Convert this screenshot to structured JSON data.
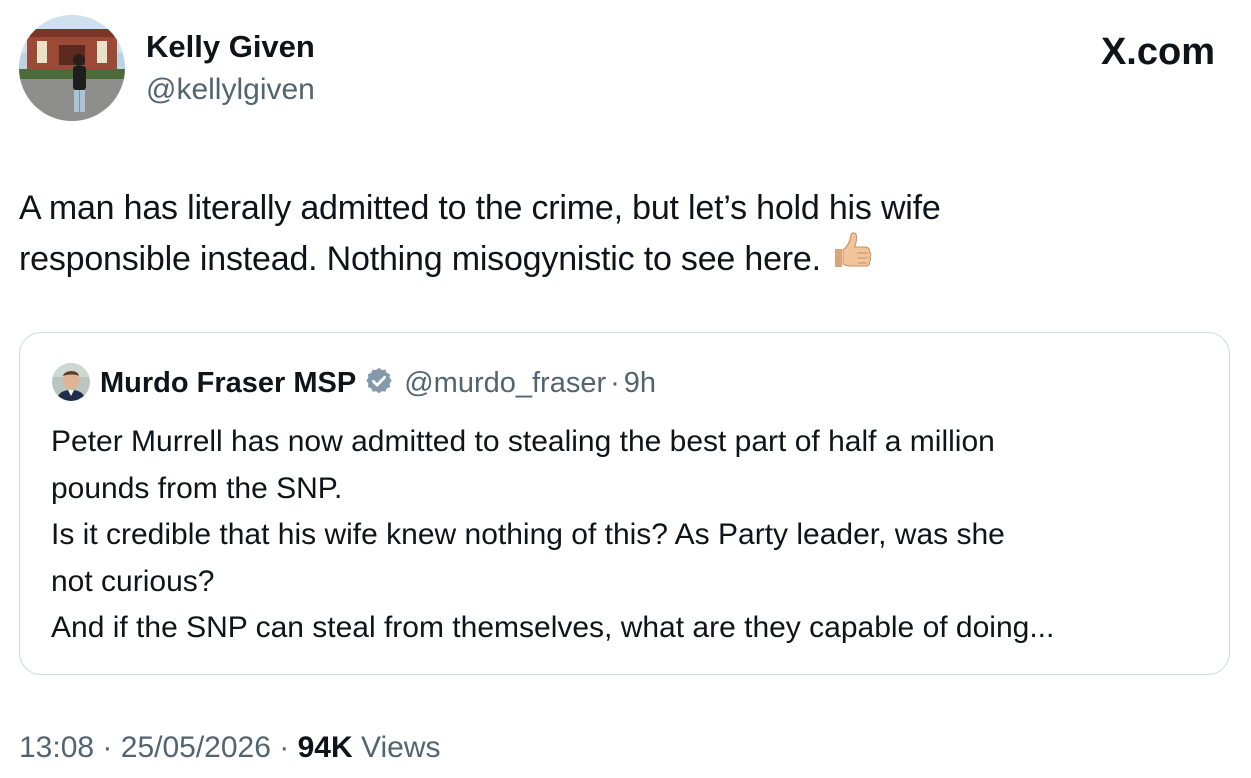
{
  "author": {
    "name": "Kelly Given",
    "handle": "@kellylgiven"
  },
  "brand": "X.com",
  "tweet": {
    "lines": [
      "A man has literally admitted to the crime, but let’s hold his wife",
      "responsible instead. Nothing misogynistic to see here."
    ],
    "emoji": "thumbs-up-icon"
  },
  "quoted": {
    "name": "Murdo Fraser MSP",
    "verified_icon": "verified-badge-icon",
    "handle": "@murdo_fraser",
    "separator": "·",
    "time": "9h",
    "lines": [
      "Peter Murrell has now admitted to stealing the best part of half a million",
      "pounds from the SNP.",
      "Is it credible that his wife knew nothing of this?  As Party leader, was she",
      "not curious?",
      "And if the SNP can steal from themselves, what are they capable of doing..."
    ]
  },
  "footer": {
    "time": "13:08",
    "separator": "·",
    "date": "25/05/2026",
    "views_count": "94K",
    "views_label": "Views"
  },
  "colors": {
    "text_primary": "#0f1419",
    "text_secondary": "#536471",
    "border": "#cfd9de",
    "verified_badge": "#829aab"
  }
}
